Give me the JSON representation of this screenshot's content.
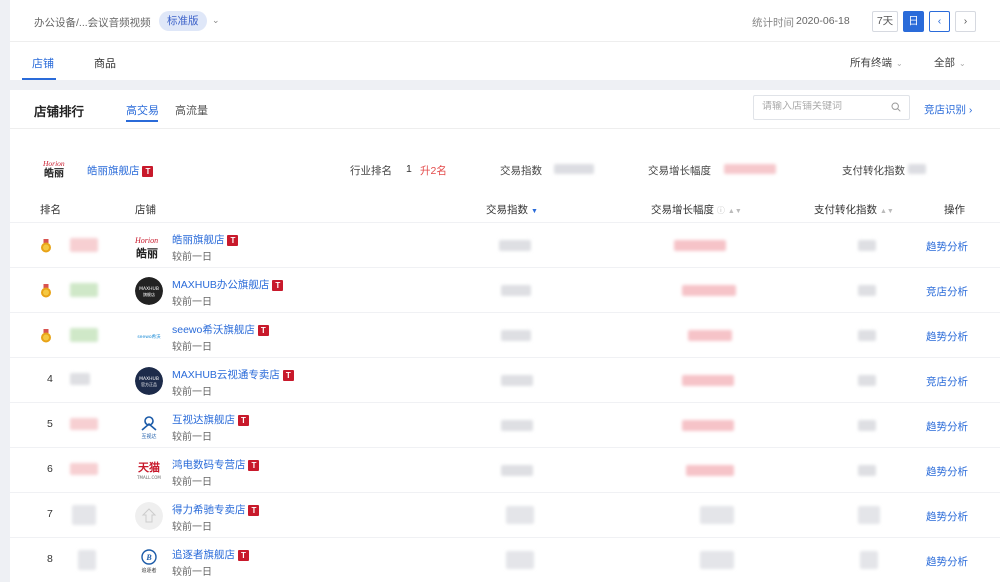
{
  "topbar": {
    "breadcrumb": "办公设备/...会议音频视频",
    "version_badge": "标准版",
    "stat_label": "统计时间",
    "stat_date": "2020-06-18",
    "period_buttons": [
      "7天",
      "日"
    ],
    "active_period": "日"
  },
  "tabs": {
    "items": [
      "店铺",
      "商品"
    ],
    "active": "店铺"
  },
  "filters": {
    "terminal": "所有终端",
    "scope": "全部"
  },
  "panel": {
    "title": "店铺排行",
    "subtabs": [
      "高交易",
      "高流量"
    ],
    "active_subtab": "高交易",
    "search_placeholder": "请输入店铺关键词",
    "compete_link": "竞店识别"
  },
  "summary": {
    "shop_name": "皓丽旗舰店",
    "tmall_mark": "T",
    "industry_rank_label": "行业排名",
    "industry_rank": "1",
    "rank_change": "升2名",
    "metric_labels": [
      "交易指数",
      "交易增长幅度",
      "支付转化指数"
    ]
  },
  "table": {
    "columns": [
      "排名",
      "店铺",
      "交易指数",
      "交易增长幅度",
      "支付转化指数",
      "操作"
    ],
    "sub_label": "较前一日",
    "rows": [
      {
        "rank": "",
        "medal": "gold",
        "name": "皓丽旗舰店",
        "logo": "horion",
        "action": "趋势分析"
      },
      {
        "rank": "",
        "medal": "gold",
        "name": "MAXHUB办公旗舰店",
        "logo": "maxhub-flag",
        "action": "竞店分析"
      },
      {
        "rank": "",
        "medal": "gold",
        "name": "seewo希沃旗舰店",
        "logo": "seewo",
        "action": "趋势分析"
      },
      {
        "rank": "4",
        "medal": "",
        "name": "MAXHUB云视通专卖店",
        "logo": "maxhub-official",
        "action": "竞店分析"
      },
      {
        "rank": "5",
        "medal": "",
        "name": "互视达旗舰店",
        "logo": "hushida",
        "action": "趋势分析"
      },
      {
        "rank": "6",
        "medal": "",
        "name": "鸿电数码专营店",
        "logo": "tmall",
        "action": "趋势分析"
      },
      {
        "rank": "7",
        "medal": "",
        "name": "得力希驰专卖店",
        "logo": "deli",
        "action": "趋势分析"
      },
      {
        "rank": "8",
        "medal": "",
        "name": "追逐者旗舰店",
        "logo": "chaser",
        "action": "趋势分析"
      }
    ]
  },
  "colors": {
    "accent": "#2a6bd9",
    "tmall_red": "#c8192b",
    "rise_red": "#e34a4a",
    "gold": "#e8a317"
  }
}
